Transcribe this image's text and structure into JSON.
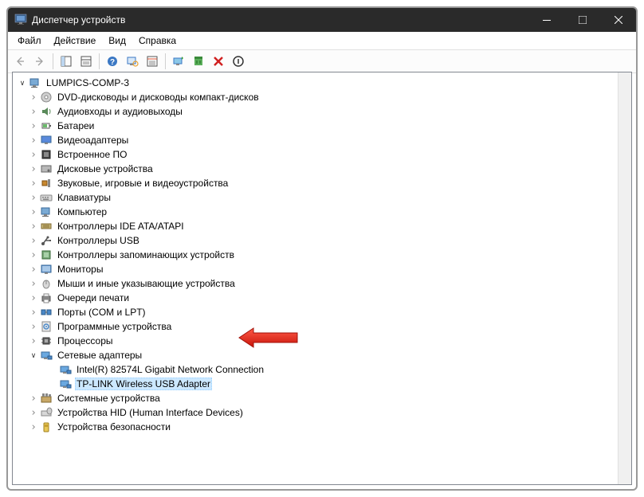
{
  "window": {
    "title": "Диспетчер устройств"
  },
  "menu": {
    "file": "Файл",
    "action": "Действие",
    "view": "Вид",
    "help": "Справка"
  },
  "tree": {
    "root": "LUMPICS-COMP-3",
    "categories": [
      {
        "label": "DVD-дисководы и дисководы компакт-дисков"
      },
      {
        "label": "Аудиовходы и аудиовыходы"
      },
      {
        "label": "Батареи"
      },
      {
        "label": "Видеоадаптеры"
      },
      {
        "label": "Встроенное ПО"
      },
      {
        "label": "Дисковые устройства"
      },
      {
        "label": "Звуковые, игровые и видеоустройства"
      },
      {
        "label": "Клавиатуры"
      },
      {
        "label": "Компьютер"
      },
      {
        "label": "Контроллеры IDE ATA/ATAPI"
      },
      {
        "label": "Контроллеры USB"
      },
      {
        "label": "Контроллеры запоминающих устройств"
      },
      {
        "label": "Мониторы"
      },
      {
        "label": "Мыши и иные указывающие устройства"
      },
      {
        "label": "Очереди печати"
      },
      {
        "label": "Порты (COM и LPT)"
      },
      {
        "label": "Программные устройства"
      },
      {
        "label": "Процессоры"
      },
      {
        "label": "Сетевые адаптеры",
        "expanded": true,
        "children": [
          {
            "label": "Intel(R) 82574L Gigabit Network Connection"
          },
          {
            "label": "TP-LINK Wireless USB Adapter",
            "selected": true
          }
        ]
      },
      {
        "label": "Системные устройства"
      },
      {
        "label": "Устройства HID (Human Interface Devices)"
      },
      {
        "label": "Устройства безопасности"
      }
    ]
  }
}
